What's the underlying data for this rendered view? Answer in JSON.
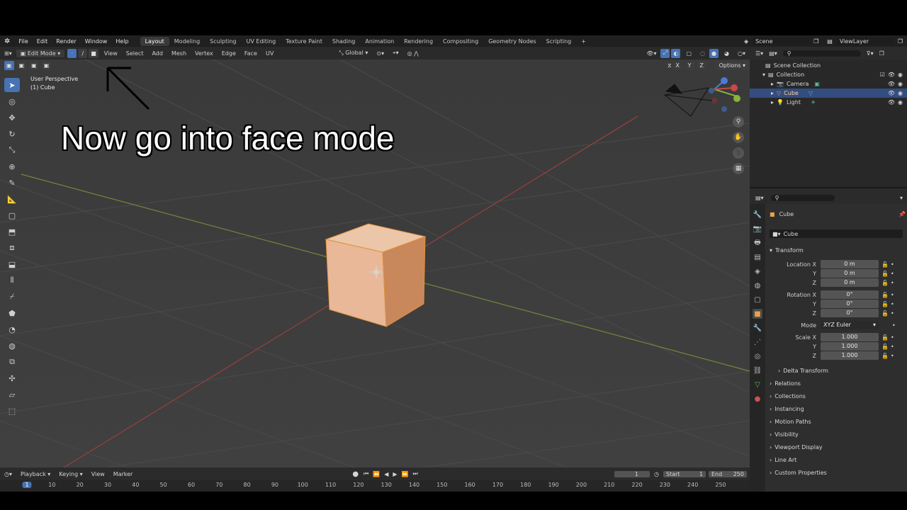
{
  "topbar": {
    "menus": [
      "File",
      "Edit",
      "Render",
      "Window",
      "Help"
    ],
    "workspaces": [
      "Layout",
      "Modeling",
      "Sculpting",
      "UV Editing",
      "Texture Paint",
      "Shading",
      "Animation",
      "Rendering",
      "Compositing",
      "Geometry Nodes",
      "Scripting"
    ],
    "add_tab": "+",
    "scene": "Scene",
    "view_layer": "ViewLayer"
  },
  "header": {
    "mode": "Edit Mode",
    "menus": [
      "View",
      "Select",
      "Add",
      "Mesh",
      "Vertex",
      "Edge",
      "Face",
      "UV"
    ],
    "orientation": "Global",
    "options": "Options",
    "axes": [
      "X",
      "Y",
      "Z"
    ]
  },
  "viewport": {
    "perspective": "User Perspective",
    "object": "(1) Cube",
    "caption": "Now go into face mode",
    "cube_color": "#e8b898"
  },
  "outliner": {
    "root": "Scene Collection",
    "collection": "Collection",
    "items": [
      "Camera",
      "Cube",
      "Light"
    ]
  },
  "properties": {
    "object_name": "Cube",
    "data_name": "Cube",
    "transform_title": "Transform",
    "location_label": "Location X",
    "rotation_label": "Rotation X",
    "scale_label": "Scale X",
    "y": "Y",
    "z": "Z",
    "location": [
      "0 m",
      "0 m",
      "0 m"
    ],
    "rotation": [
      "0°",
      "0°",
      "0°"
    ],
    "mode_label": "Mode",
    "mode_value": "XYZ Euler",
    "scale": [
      "1.000",
      "1.000",
      "1.000"
    ],
    "sections": [
      "Delta Transform",
      "Relations",
      "Collections",
      "Instancing",
      "Motion Paths",
      "Visibility",
      "Viewport Display",
      "Line Art",
      "Custom Properties"
    ]
  },
  "timeline": {
    "menus": [
      "Playback",
      "Keying",
      "View",
      "Marker"
    ],
    "current_frame": "1",
    "start_label": "Start",
    "start": "1",
    "end_label": "End",
    "end": "250",
    "ticks": [
      "1",
      "10",
      "20",
      "30",
      "40",
      "50",
      "60",
      "70",
      "80",
      "90",
      "100",
      "110",
      "120",
      "130",
      "140",
      "150",
      "160",
      "170",
      "180",
      "190",
      "200",
      "210",
      "220",
      "230",
      "240",
      "250"
    ]
  }
}
